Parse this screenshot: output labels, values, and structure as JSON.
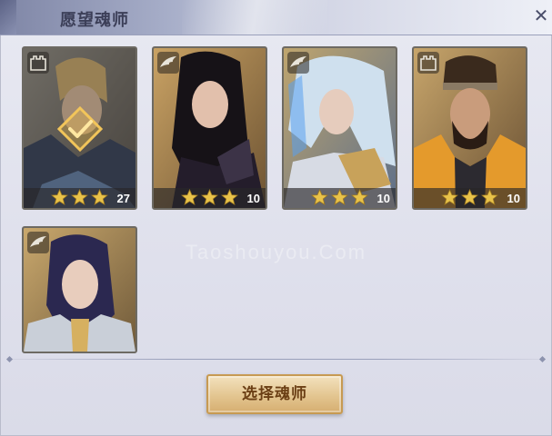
{
  "header": {
    "title": "愿望魂师"
  },
  "watermark": "Taoshouyou.Com",
  "colors": {
    "accent_gold": "#c79a52",
    "star": "#e8c24a",
    "header": "#7f86a6"
  },
  "cards": [
    {
      "stars": 3,
      "level": "27",
      "badge_icon": "fortress-icon",
      "selected": true
    },
    {
      "stars": 3,
      "level": "10",
      "badge_icon": "wing-icon",
      "selected": false
    },
    {
      "stars": 3,
      "level": "10",
      "badge_icon": "wing-icon",
      "selected": false
    },
    {
      "stars": 3,
      "level": "10",
      "badge_icon": "fortress-icon",
      "selected": false
    },
    {
      "stars": 0,
      "level": "",
      "badge_icon": "wing-icon",
      "selected": false
    }
  ],
  "select_button": {
    "label": "选择魂师"
  }
}
